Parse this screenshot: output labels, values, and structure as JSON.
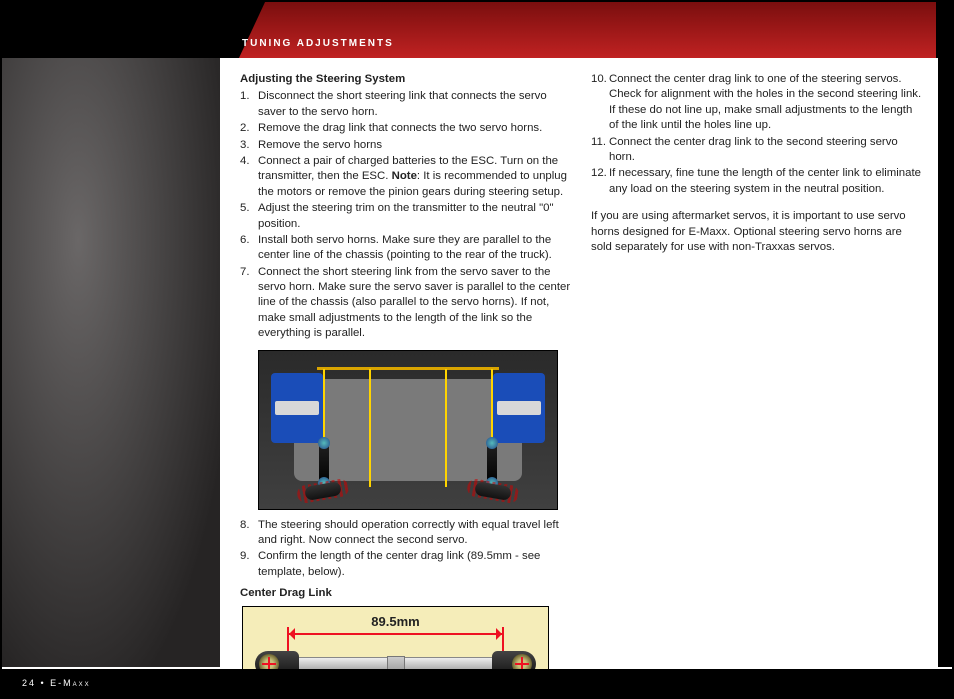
{
  "header": {
    "title": "Tuning Adjustments"
  },
  "footer": {
    "text": "24 • E-Maxx"
  },
  "left": {
    "heading": "Adjusting the Steering System",
    "steps_a": [
      "Disconnect the short steering link that connects the servo saver to the servo horn.",
      "Remove the drag link that connects the two servo horns.",
      "Remove the servo horns",
      "Connect a pair of charged batteries to the ESC.  Turn on the transmitter, then the ESC.  ",
      "Adjust the steering trim on the transmitter to the neutral \"0\" position.",
      "Install both servo horns.  Make sure they are parallel to the center line of the chassis (pointing to the rear of the truck).",
      "Connect the short steering link from the servo saver to the servo horn. Make sure the servo saver is parallel to the center line of the chassis (also parallel to the servo horns).  If not, make small adjustments to the length of the link so the everything is parallel."
    ],
    "step4_note_label": "Note",
    "step4_note_text": ": It is recommended to unplug the motors or remove the pinion gears during steering setup.",
    "steps_b_start": 8,
    "steps_b": [
      "The steering should operation correctly with equal travel left and right.  Now connect the second servo.",
      "Confirm the length of the center drag link (89.5mm - see template, below)."
    ],
    "drag_link_heading": "Center Drag Link",
    "drag_link_dim": "89.5mm"
  },
  "right": {
    "steps_start": 10,
    "steps": [
      "Connect the center drag link to one of the steering servos. Check for alignment with the holes in the second steering link. If these do not line up, make small adjustments to the length of the link until the holes line up.",
      "Connect the center drag link to the second steering servo horn.",
      "If necessary, fine tune the length of the center link to eliminate any load on the steering system in the neutral position."
    ],
    "paragraph": "If you are using aftermarket servos, it is important to use servo horns designed for E-Maxx.  Optional steering servo horns are sold separately for use with non-Traxxas servos."
  }
}
